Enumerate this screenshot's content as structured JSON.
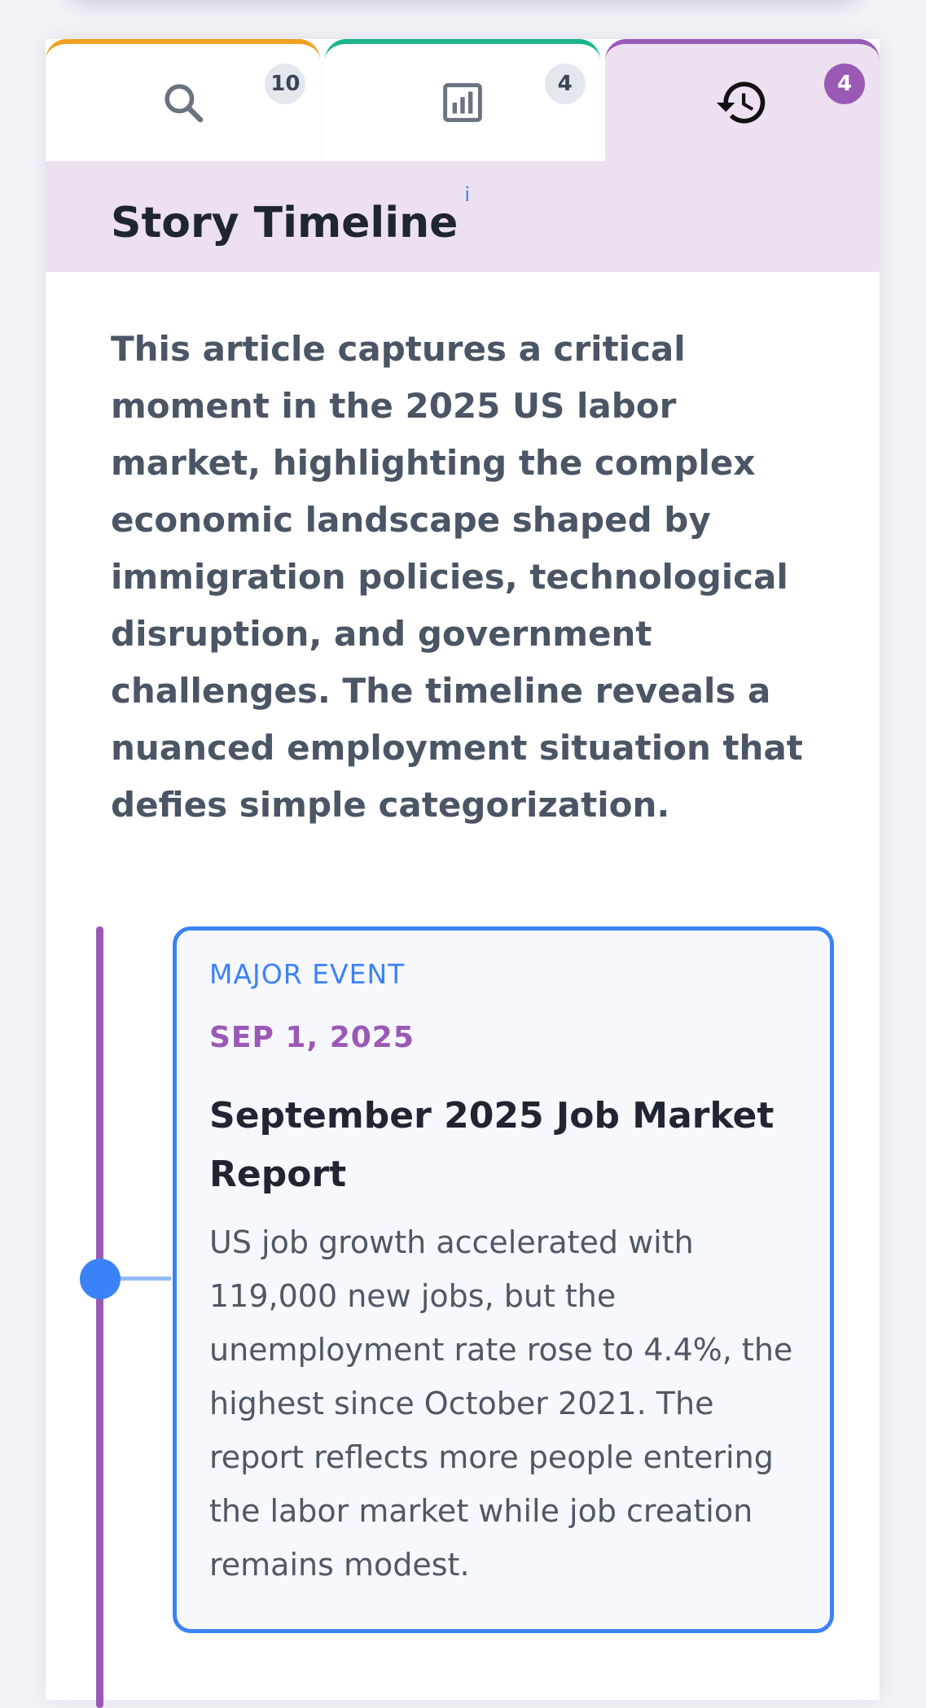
{
  "tabs": [
    {
      "name": "search",
      "icon": "search-icon",
      "badge": "10",
      "accent": "#f0a020"
    },
    {
      "name": "charts",
      "icon": "bar-chart-icon",
      "badge": "4",
      "accent": "#1bb58a"
    },
    {
      "name": "history",
      "icon": "history-icon",
      "badge": "4",
      "accent": "#9b59b6",
      "active": true
    }
  ],
  "header": {
    "title": "Story Timeline",
    "info_icon": "i"
  },
  "summary": "This article captures a critical moment in the 2025 US labor market, highlighting the complex economic landscape shaped by immigration policies, technological disruption, and government challenges. The timeline reveals a nuanced employment situation that defies simple categorization.",
  "timeline": {
    "events": [
      {
        "type": "MAJOR EVENT",
        "date": "SEP 1, 2025",
        "title": "September 2025 Job Market Report",
        "description": "US job growth accelerated with 119,000 new jobs, but the unemployment rate rose to 4.4%, the highest since October 2021. The report reflects more people entering the labor market while job creation remains modest."
      }
    ]
  },
  "colors": {
    "accent_purple": "#9b59b6",
    "accent_blue": "#3b82f6",
    "accent_orange": "#f0a020",
    "accent_green": "#1bb58a",
    "header_bg": "#ede0f0"
  }
}
